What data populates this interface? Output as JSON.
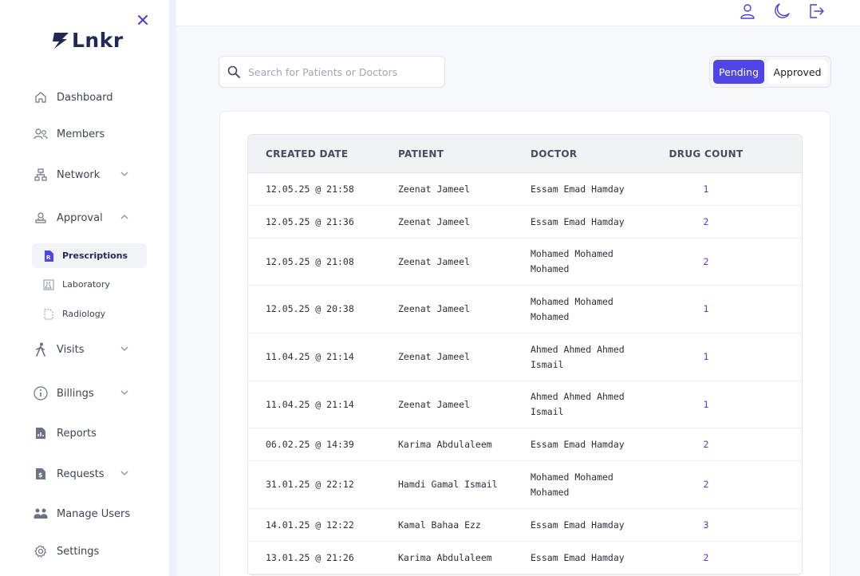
{
  "app": {
    "logo_text": "Lnkr"
  },
  "sidebar": {
    "items": [
      {
        "label": "Dashboard",
        "icon": "home-icon"
      },
      {
        "label": "Members",
        "icon": "users-icon"
      },
      {
        "label": "Network",
        "icon": "network-icon",
        "chevron": "down"
      },
      {
        "label": "Approval",
        "icon": "approval-icon",
        "chevron": "up"
      },
      {
        "label": "Visits",
        "icon": "walking-icon",
        "chevron": "down"
      },
      {
        "label": "Billings",
        "icon": "info-circle-icon",
        "chevron": "down"
      },
      {
        "label": "Reports",
        "icon": "report-icon"
      },
      {
        "label": "Requests",
        "icon": "dollar-doc-icon",
        "chevron": "down"
      },
      {
        "label": "Manage Users",
        "icon": "group-icon"
      },
      {
        "label": "Settings",
        "icon": "gear-icon"
      }
    ],
    "approval_subitems": [
      {
        "label": "Prescriptions",
        "icon": "rx-icon",
        "active": true
      },
      {
        "label": "Laboratory",
        "icon": "lab-icon",
        "active": false
      },
      {
        "label": "Radiology",
        "icon": "radiology-icon",
        "active": false
      }
    ]
  },
  "topbar": {
    "icons": [
      "user-icon",
      "moon-icon",
      "logout-icon"
    ]
  },
  "search": {
    "placeholder": "Search for Patients or Doctors",
    "value": ""
  },
  "status_toggle": {
    "pending": "Pending",
    "approved": "Approved",
    "selected": "Pending"
  },
  "colors": {
    "accent": "#5046e5",
    "brand": "#1f2b55"
  },
  "table": {
    "columns": [
      "CREATED DATE",
      "PATIENT",
      "DOCTOR",
      "DRUG COUNT"
    ],
    "rows": [
      {
        "date": "12.05.25 @ 21:58",
        "patient": "Zeenat Jameel",
        "doctor": "Essam Emad Hamday",
        "count": "1"
      },
      {
        "date": "12.05.25 @ 21:36",
        "patient": "Zeenat Jameel",
        "doctor": "Essam Emad Hamday",
        "count": "2"
      },
      {
        "date": "12.05.25 @ 21:08",
        "patient": "Zeenat Jameel",
        "doctor": "Mohamed Mohamed Mohamed",
        "count": "2"
      },
      {
        "date": "12.05.25 @ 20:38",
        "patient": "Zeenat Jameel",
        "doctor": "Mohamed Mohamed Mohamed",
        "count": "1"
      },
      {
        "date": "11.04.25 @ 21:14",
        "patient": "Zeenat Jameel",
        "doctor": "Ahmed Ahmed Ahmed Ismail",
        "count": "1"
      },
      {
        "date": "11.04.25 @ 21:14",
        "patient": "Zeenat Jameel",
        "doctor": "Ahmed Ahmed Ahmed Ismail",
        "count": "1"
      },
      {
        "date": "06.02.25 @ 14:39",
        "patient": "Karima Abdulaleem",
        "doctor": "Essam Emad Hamday",
        "count": "2"
      },
      {
        "date": "31.01.25 @ 22:12",
        "patient": "Hamdi Gamal Ismail",
        "doctor": "Mohamed Mohamed Mohamed",
        "count": "2"
      },
      {
        "date": "14.01.25 @ 12:22",
        "patient": "Kamal Bahaa Ezz",
        "doctor": "Essam Emad Hamday",
        "count": "3"
      },
      {
        "date": "13.01.25 @ 21:26",
        "patient": "Karima Abdulaleem",
        "doctor": "Essam Emad Hamday",
        "count": "2"
      }
    ]
  }
}
